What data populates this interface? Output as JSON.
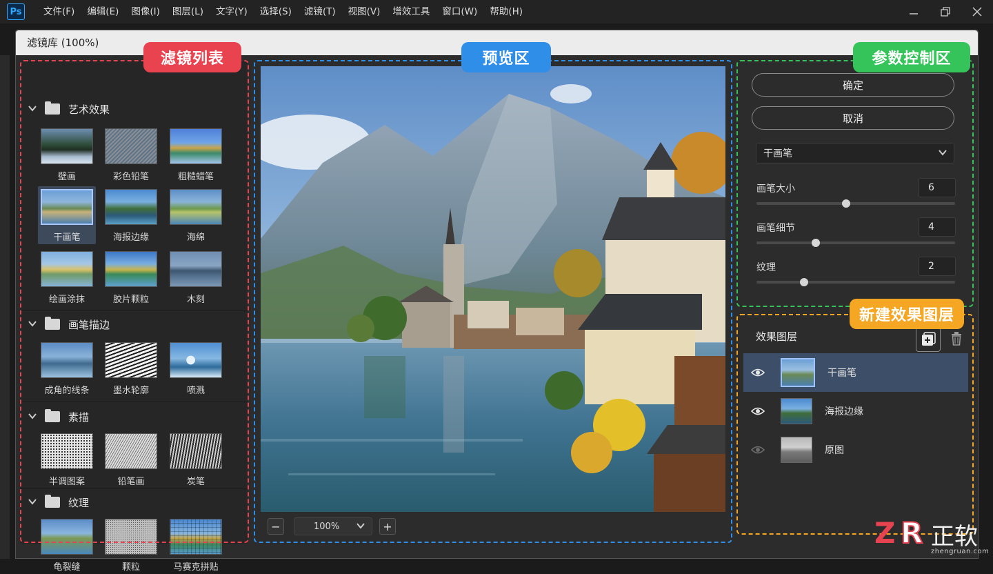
{
  "app": {
    "logo": "Ps",
    "menu": [
      "文件(F)",
      "编辑(E)",
      "图像(I)",
      "图层(L)",
      "文字(Y)",
      "选择(S)",
      "滤镜(T)",
      "视图(V)",
      "增效工具",
      "窗口(W)",
      "帮助(H)"
    ],
    "window_controls": [
      "minimize-icon",
      "restore-icon",
      "close-icon"
    ]
  },
  "dialog": {
    "title": "滤镜库 (100%)"
  },
  "badges": {
    "filter_list": "滤镜列表",
    "preview": "预览区",
    "params": "参数控制区",
    "new_layer": "新建效果图层"
  },
  "filter_list": {
    "categories": [
      {
        "name": "艺术效果",
        "items": [
          "壁画",
          "彩色铅笔",
          "粗糙蜡笔",
          "干画笔",
          "海报边缘",
          "海绵",
          "绘画涂抹",
          "胶片颗粒",
          "木刻"
        ]
      },
      {
        "name": "画笔描边",
        "items": [
          "成角的线条",
          "墨水轮廓",
          "喷溅"
        ]
      },
      {
        "name": "素描",
        "items": [
          "半调图案",
          "铅笔画",
          "炭笔"
        ]
      },
      {
        "name": "纹理",
        "items": [
          "龟裂缝",
          "颗粒",
          "马赛克拼贴"
        ]
      }
    ],
    "selected": "干画笔"
  },
  "preview": {
    "zoom": "100%",
    "zoom_out": "−",
    "zoom_in": "+"
  },
  "params": {
    "ok_label": "确定",
    "cancel_label": "取消",
    "filter_select": "干画笔",
    "controls": [
      {
        "label": "画笔大小",
        "value": "6",
        "fraction": 0.45
      },
      {
        "label": "画笔细节",
        "value": "4",
        "fraction": 0.3
      },
      {
        "label": "纹理",
        "value": "2",
        "fraction": 0.24
      }
    ]
  },
  "layers": {
    "title": "效果图层",
    "items": [
      {
        "name": "干画笔",
        "visible": true,
        "active": true
      },
      {
        "name": "海报边缘",
        "visible": true,
        "active": false
      },
      {
        "name": "原图",
        "visible": false,
        "active": false
      }
    ]
  },
  "watermark": {
    "brand": "正软",
    "url": "zhengruan.com"
  },
  "colors": {
    "red_badge": "#e8434f",
    "blue_badge": "#2f8fe8",
    "green_badge": "#35c45a",
    "orange_badge": "#f5a623",
    "selection": "#3d4f68"
  }
}
